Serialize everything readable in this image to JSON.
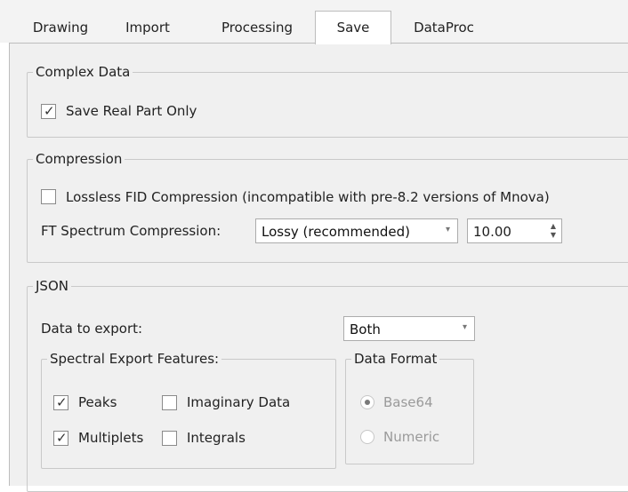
{
  "tabs": [
    {
      "label": "Drawing"
    },
    {
      "label": "Import"
    },
    {
      "label": "Processing"
    },
    {
      "label": "Save"
    },
    {
      "label": "DataProc"
    }
  ],
  "active_tab": "Save",
  "complex_data": {
    "title": "Complex Data",
    "save_real_part_only": {
      "label": "Save Real Part Only",
      "checked": true
    }
  },
  "compression": {
    "title": "Compression",
    "lossless": {
      "label": "Lossless FID Compression (incompatible with pre-8.2 versions of Mnova)",
      "checked": false
    },
    "ft_label": "FT Spectrum Compression:",
    "ft_select_value": "Lossy (recommended)",
    "ft_spin_value": "10.00"
  },
  "json": {
    "title": "JSON",
    "data_to_export_label": "Data to export:",
    "data_to_export_value": "Both",
    "spectral": {
      "title": "Spectral Export Features:",
      "peaks": {
        "label": "Peaks",
        "checked": true
      },
      "imaginary": {
        "label": "Imaginary Data",
        "checked": false
      },
      "multiplets": {
        "label": "Multiplets",
        "checked": true
      },
      "integrals": {
        "label": "Integrals",
        "checked": false
      }
    },
    "format": {
      "title": "Data Format",
      "base64": {
        "label": "Base64",
        "selected": true
      },
      "numeric": {
        "label": "Numeric",
        "selected": false
      }
    }
  },
  "icons": {
    "check": "✓",
    "dropdown_arrow": "▾",
    "spin_up": "▲",
    "spin_down": "▼"
  }
}
